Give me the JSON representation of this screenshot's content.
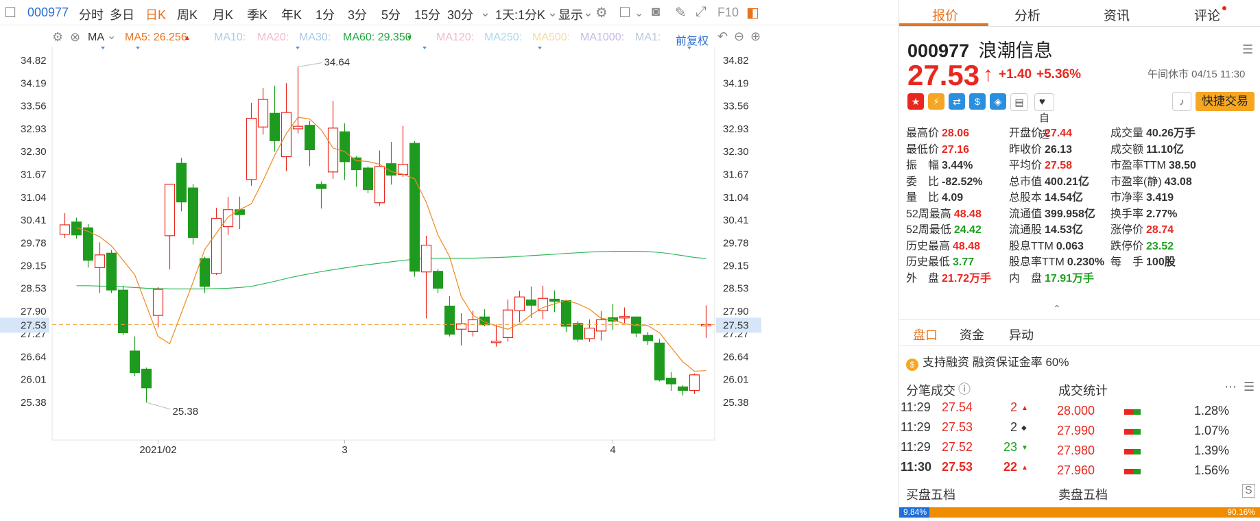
{
  "toolbar": {
    "code": "000977",
    "items": [
      "分时",
      "多日",
      "日K",
      "周K",
      "月K",
      "季K",
      "年K",
      "1分",
      "3分",
      "5分",
      "15分",
      "30分"
    ],
    "active": "日K",
    "period_select": "1天:1分K",
    "display_label": "显示",
    "f10_label": "F10"
  },
  "ma_bar": {
    "label": "MA",
    "ma5": "MA5: 26.256",
    "ma10": "MA10:",
    "ma20": "MA20:",
    "ma30": "MA30:",
    "ma60": "MA60: 29.350",
    "ma120": "MA120:",
    "ma250": "MA250:",
    "ma500": "MA500:",
    "ma1000": "MA1000:",
    "ma1": "MA1:",
    "adjust": "前复权"
  },
  "chart_data": {
    "type": "candlestick",
    "y_ticks": [
      34.82,
      34.19,
      33.56,
      32.93,
      32.3,
      31.67,
      31.04,
      30.41,
      29.78,
      29.15,
      28.53,
      27.9,
      27.27,
      26.64,
      26.01,
      25.38
    ],
    "ylim": [
      25.0,
      35.2
    ],
    "x_labels": [
      {
        "label": "2021/02",
        "index": 8
      },
      {
        "label": "3",
        "index": 24
      },
      {
        "label": "4",
        "index": 47
      }
    ],
    "current_price": 27.53,
    "max_label": "34.64",
    "max_index": 20,
    "min_label": "25.38",
    "min_index": 7,
    "candles": [
      {
        "o": 30.02,
        "c": 30.28,
        "h": 30.6,
        "l": 29.92
      },
      {
        "o": 30.36,
        "c": 30.0,
        "h": 30.48,
        "l": 29.9
      },
      {
        "o": 30.2,
        "c": 29.3,
        "h": 30.3,
        "l": 29.1
      },
      {
        "o": 29.1,
        "c": 29.45,
        "h": 29.8,
        "l": 28.4
      },
      {
        "o": 29.5,
        "c": 28.48,
        "h": 29.58,
        "l": 28.4
      },
      {
        "o": 28.48,
        "c": 27.3,
        "h": 28.6,
        "l": 27.24
      },
      {
        "o": 26.8,
        "c": 26.2,
        "h": 27.2,
        "l": 26.1
      },
      {
        "o": 26.3,
        "c": 25.78,
        "h": 26.34,
        "l": 25.38
      },
      {
        "o": 27.78,
        "c": 28.5,
        "h": 28.56,
        "l": 27.45
      },
      {
        "o": 29.98,
        "c": 31.4,
        "h": 31.41,
        "l": 29.05
      },
      {
        "o": 31.98,
        "c": 30.91,
        "h": 32.13,
        "l": 30.65
      },
      {
        "o": 31.3,
        "c": 29.93,
        "h": 31.41,
        "l": 29.74
      },
      {
        "o": 29.35,
        "c": 28.58,
        "h": 29.4,
        "l": 28.4
      },
      {
        "o": 28.94,
        "c": 30.46,
        "h": 30.75,
        "l": 28.9
      },
      {
        "o": 30.23,
        "c": 30.7,
        "h": 31.05,
        "l": 30.0
      },
      {
        "o": 30.7,
        "c": 30.56,
        "h": 31.06,
        "l": 30.16
      },
      {
        "o": 31.53,
        "c": 33.22,
        "h": 33.65,
        "l": 31.36
      },
      {
        "o": 32.98,
        "c": 33.74,
        "h": 34.06,
        "l": 32.77
      },
      {
        "o": 33.36,
        "c": 32.6,
        "h": 34.12,
        "l": 32.3
      },
      {
        "o": 32.16,
        "c": 33.38,
        "h": 34.19,
        "l": 31.76
      },
      {
        "o": 32.93,
        "c": 33.0,
        "h": 34.64,
        "l": 32.8
      },
      {
        "o": 33.03,
        "c": 32.35,
        "h": 33.15,
        "l": 31.9
      },
      {
        "o": 31.4,
        "c": 31.28,
        "h": 31.48,
        "l": 30.73
      },
      {
        "o": 31.74,
        "c": 32.95,
        "h": 33.7,
        "l": 31.55
      },
      {
        "o": 32.85,
        "c": 32.02,
        "h": 33.08,
        "l": 31.52
      },
      {
        "o": 32.13,
        "c": 31.8,
        "h": 32.18,
        "l": 31.33
      },
      {
        "o": 31.85,
        "c": 31.25,
        "h": 31.9,
        "l": 31.15
      },
      {
        "o": 30.89,
        "c": 31.89,
        "h": 32.33,
        "l": 30.8
      },
      {
        "o": 31.97,
        "c": 31.65,
        "h": 32.57,
        "l": 31.39
      },
      {
        "o": 31.67,
        "c": 31.95,
        "h": 33.01,
        "l": 31.6
      },
      {
        "o": 32.53,
        "c": 29.0,
        "h": 32.59,
        "l": 28.85
      },
      {
        "o": 28.98,
        "c": 29.72,
        "h": 29.98,
        "l": 27.7
      },
      {
        "o": 29.0,
        "c": 28.53,
        "h": 29.06,
        "l": 28.4
      },
      {
        "o": 28.04,
        "c": 27.26,
        "h": 28.31,
        "l": 27.2
      },
      {
        "o": 27.4,
        "c": 27.55,
        "h": 27.84,
        "l": 26.95
      },
      {
        "o": 27.34,
        "c": 27.66,
        "h": 27.91,
        "l": 27.2
      },
      {
        "o": 27.74,
        "c": 27.52,
        "h": 27.95,
        "l": 27.48
      },
      {
        "o": 27.03,
        "c": 27.07,
        "h": 27.53,
        "l": 26.92
      },
      {
        "o": 27.17,
        "c": 27.93,
        "h": 28.22,
        "l": 27.06
      },
      {
        "o": 27.91,
        "c": 28.29,
        "h": 28.46,
        "l": 27.59
      },
      {
        "o": 28.21,
        "c": 28.06,
        "h": 28.58,
        "l": 27.71
      },
      {
        "o": 27.91,
        "c": 28.25,
        "h": 28.6,
        "l": 27.68
      },
      {
        "o": 28.23,
        "c": 28.17,
        "h": 28.47,
        "l": 27.87
      },
      {
        "o": 28.19,
        "c": 27.48,
        "h": 28.2,
        "l": 27.32
      },
      {
        "o": 27.56,
        "c": 27.12,
        "h": 27.62,
        "l": 27.05
      },
      {
        "o": 27.14,
        "c": 27.43,
        "h": 27.67,
        "l": 27.05
      },
      {
        "o": 27.35,
        "c": 27.66,
        "h": 27.9,
        "l": 27.09
      },
      {
        "o": 27.72,
        "c": 27.62,
        "h": 28.1,
        "l": 27.38
      },
      {
        "o": 27.71,
        "c": 27.75,
        "h": 28.0,
        "l": 27.57
      },
      {
        "o": 27.74,
        "c": 27.29,
        "h": 27.75,
        "l": 27.18
      },
      {
        "o": 27.23,
        "c": 27.08,
        "h": 27.32,
        "l": 26.97
      },
      {
        "o": 27.02,
        "c": 26.0,
        "h": 27.13,
        "l": 25.96
      },
      {
        "o": 26.05,
        "c": 25.89,
        "h": 26.22,
        "l": 25.7
      },
      {
        "o": 25.81,
        "c": 25.71,
        "h": 25.85,
        "l": 25.57
      },
      {
        "o": 25.71,
        "c": 26.14,
        "h": 26.18,
        "l": 25.61
      },
      {
        "o": 27.49,
        "c": 27.53,
        "h": 28.06,
        "l": 27.16
      }
    ],
    "ma5": [
      30.2,
      30.1,
      29.95,
      29.7,
      29.3,
      28.9,
      28.05,
      27.2,
      27.0,
      27.85,
      28.7,
      29.6,
      30.05,
      30.5,
      30.7,
      30.86,
      31.5,
      32.2,
      32.8,
      33.25,
      33.2,
      32.9,
      32.4,
      32.3,
      32.05,
      32.03,
      31.95,
      31.75,
      31.68,
      31.55,
      30.9,
      30.0,
      29.4,
      28.3,
      27.78,
      27.6,
      27.49,
      27.4,
      27.55,
      27.8,
      28.0,
      28.1,
      28.2,
      28.1,
      27.95,
      27.7,
      27.66,
      27.55,
      27.5,
      27.5,
      27.3,
      26.9,
      26.5,
      26.24,
      26.256
    ],
    "ma60": [
      28.6,
      28.6,
      28.59,
      28.58,
      28.57,
      28.55,
      28.53,
      28.52,
      28.51,
      28.51,
      28.51,
      28.51,
      28.52,
      28.53,
      28.55,
      28.58,
      28.65,
      28.72,
      28.8,
      28.87,
      28.93,
      28.99,
      29.04,
      29.09,
      29.14,
      29.18,
      29.22,
      29.26,
      29.3,
      29.33,
      29.35,
      29.36,
      29.36,
      29.36,
      29.36,
      29.37,
      29.38,
      29.39,
      29.41,
      29.43,
      29.45,
      29.47,
      29.49,
      29.51,
      29.53,
      29.54,
      29.55,
      29.55,
      29.55,
      29.54,
      29.52,
      29.48,
      29.43,
      29.38,
      29.35
    ]
  },
  "quote": {
    "tabs": [
      "报价",
      "分析",
      "资讯",
      "评论"
    ],
    "active_tab": "报价",
    "code": "000977",
    "name": "浪潮信息",
    "price": "27.53",
    "change": "+1.40",
    "pct": "+5.36%",
    "status": "午间休市 04/15 11:30",
    "fav_label": "自选",
    "quick_trade": "快捷交易",
    "stats": [
      {
        "label": "最高价",
        "value": "28.06",
        "color": "red"
      },
      {
        "label": "开盘价",
        "value": "27.44",
        "color": "red"
      },
      {
        "label": "成交量",
        "value": "40.26万手",
        "color": "dark"
      },
      {
        "label": "最低价",
        "value": "27.16",
        "color": "red"
      },
      {
        "label": "昨收价",
        "value": "26.13",
        "color": "dark"
      },
      {
        "label": "成交额",
        "value": "11.10亿",
        "color": "dark"
      },
      {
        "label": "振　幅",
        "value": "3.44%",
        "color": "dark"
      },
      {
        "label": "平均价",
        "value": "27.58",
        "color": "red"
      },
      {
        "label": "市盈率TTM",
        "value": "38.50",
        "color": "dark"
      },
      {
        "label": "委　比",
        "value": "-82.52%",
        "color": "dark"
      },
      {
        "label": "总市值",
        "value": "400.21亿",
        "color": "dark"
      },
      {
        "label": "市盈率(静)",
        "value": "43.08",
        "color": "dark"
      },
      {
        "label": "量　比",
        "value": "4.09",
        "color": "dark"
      },
      {
        "label": "总股本",
        "value": "14.54亿",
        "color": "dark"
      },
      {
        "label": "市净率",
        "value": "3.419",
        "color": "dark"
      },
      {
        "label": "52周最高",
        "value": "48.48",
        "color": "red"
      },
      {
        "label": "流通值",
        "value": "399.958亿",
        "color": "dark"
      },
      {
        "label": "换手率",
        "value": "2.77%",
        "color": "dark"
      },
      {
        "label": "52周最低",
        "value": "24.42",
        "color": "green"
      },
      {
        "label": "流通股",
        "value": "14.53亿",
        "color": "dark"
      },
      {
        "label": "涨停价",
        "value": "28.74",
        "color": "red"
      },
      {
        "label": "历史最高",
        "value": "48.48",
        "color": "red"
      },
      {
        "label": "股息TTM",
        "value": "0.063",
        "color": "dark"
      },
      {
        "label": "跌停价",
        "value": "23.52",
        "color": "green"
      },
      {
        "label": "历史最低",
        "value": "3.77",
        "color": "green"
      },
      {
        "label": "股息率TTM",
        "value": "0.230%",
        "color": "dark"
      },
      {
        "label": "每　手",
        "value": "100股",
        "color": "dark"
      },
      {
        "label": "外　盘",
        "value": "21.72万手",
        "color": "red"
      },
      {
        "label": "内　盘",
        "value": "17.91万手",
        "color": "green"
      }
    ],
    "subtabs": [
      "盘口",
      "资金",
      "异动"
    ],
    "active_subtab": "盘口",
    "margin_text": "支持融资 融资保证金率 60%",
    "trades_title": "分笔成交",
    "stats_title": "成交统计",
    "trades": [
      {
        "time": "11:29",
        "price": "27.54",
        "vol": "2",
        "dir": "up"
      },
      {
        "time": "11:29",
        "price": "27.53",
        "vol": "2",
        "dir": "flat"
      },
      {
        "time": "11:29",
        "price": "27.52",
        "vol": "23",
        "dir": "down"
      },
      {
        "time": "11:30",
        "price": "27.53",
        "vol": "22",
        "dir": "up"
      }
    ],
    "price_stats": [
      {
        "price": "28.000",
        "pct": "1.28%"
      },
      {
        "price": "27.990",
        "pct": "1.07%"
      },
      {
        "price": "27.980",
        "pct": "1.39%"
      },
      {
        "price": "27.960",
        "pct": "1.56%"
      }
    ],
    "bid_title": "买盘五档",
    "ask_title": "卖盘五档",
    "bid_ratio_label": "9.84%",
    "bid_ratio": 0.084,
    "ask_ratio_label": "90.16%"
  }
}
